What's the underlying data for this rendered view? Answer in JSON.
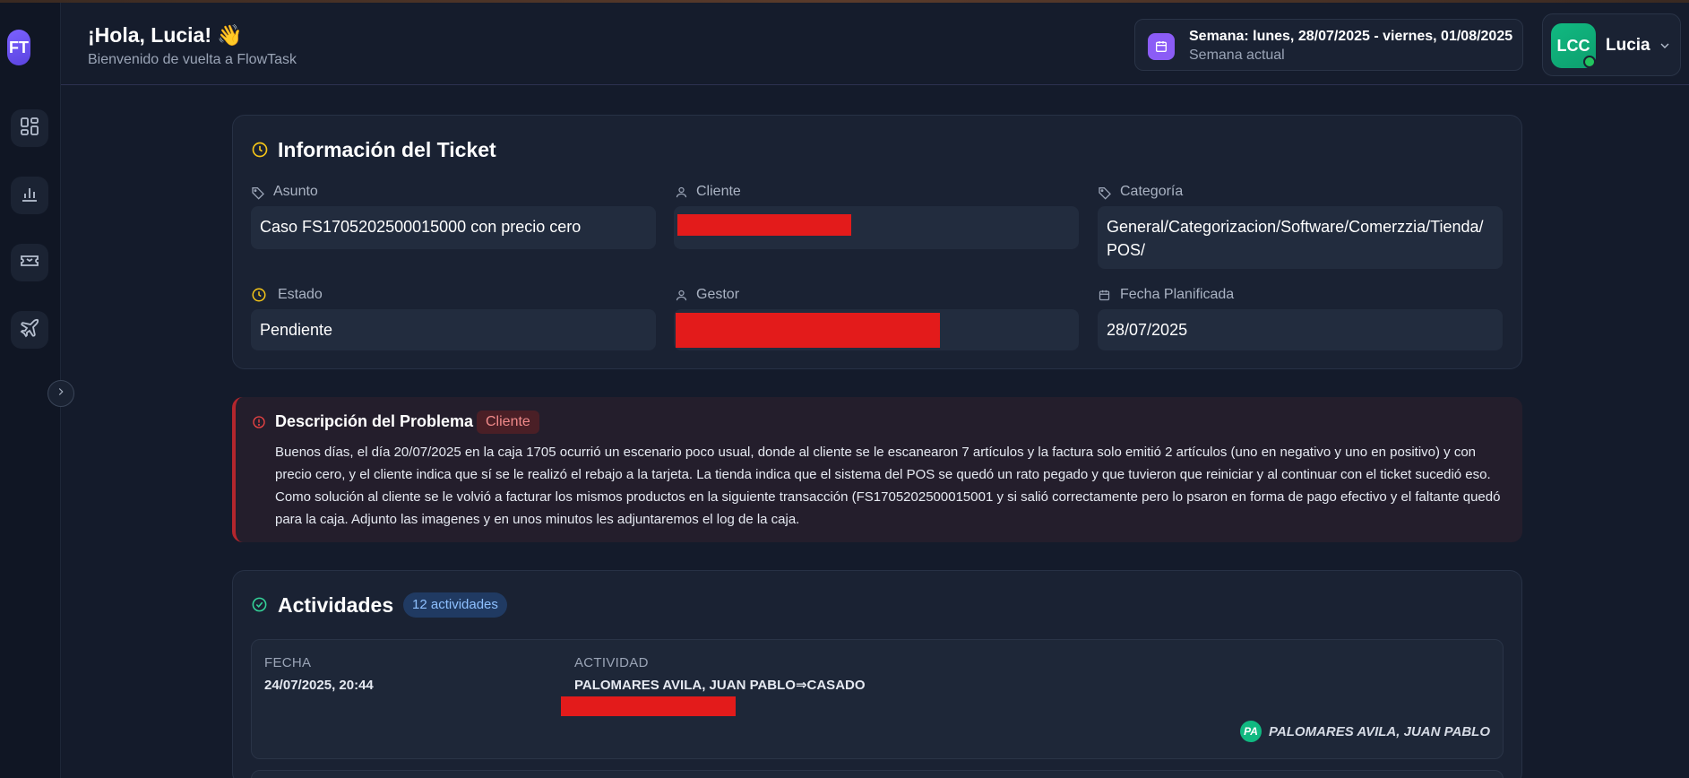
{
  "header": {
    "greeting": "¡Hola, Lucia! 👋",
    "subtitle": "Bienvenido de vuelta a FlowTask",
    "week_title": "Semana: lunes, 28/07/2025 - viernes, 01/08/2025",
    "week_sub": "Semana actual",
    "user_initials": "LCC",
    "user_name": "Lucia"
  },
  "sidebar": {
    "logo": "FT",
    "items": [
      {
        "name": "dashboard-icon"
      },
      {
        "name": "chart-icon"
      },
      {
        "name": "ticket-icon"
      },
      {
        "name": "plane-icon"
      }
    ]
  },
  "ticket_info": {
    "title": "Información del Ticket",
    "fields": {
      "asunto_label": "Asunto",
      "asunto_value": "Caso FS1705202500015000 con precio cero",
      "cliente_label": "Cliente",
      "categoria_label": "Categoría",
      "categoria_value": "General/Categorizacion/Software/Comerzzia/Tienda/POS/",
      "estado_label": "Estado",
      "estado_value": "Pendiente",
      "gestor_label": "Gestor",
      "fecha_label": "Fecha Planificada",
      "fecha_value": "28/07/2025"
    }
  },
  "problem": {
    "title": "Descripción del Problema",
    "badge": "Cliente",
    "text": "Buenos días, el día 20/07/2025 en la caja 1705 ocurrió un escenario poco usual, donde al cliente se le escanearon 7 artículos y la factura solo emitió 2 artículos (uno en negativo y uno en positivo) y con precio cero, y el cliente indica que sí se le realizó el rebajo a la tarjeta. La tienda indica que el sistema del POS se quedó un rato pegado y que tuvieron que reiniciar y al continuar con el ticket sucedió eso. Como solución al cliente se le volvió a facturar los mismos productos en la siguiente transacción (FS1705202500015001 y si salió correctamente pero lo psaron en forma de pago efectivo y el faltante quedó para la caja. Adjunto las imagenes y en unos minutos les adjuntaremos el log de la caja."
  },
  "activities": {
    "title": "Actividades",
    "count": "12 actividades",
    "col_fecha": "FECHA",
    "col_actividad": "ACTIVIDAD",
    "rows": [
      {
        "fecha": "24/07/2025, 20:44",
        "actividad": "PALOMARES AVILA, JUAN PABLO⇒CASADO",
        "user_initials": "PA",
        "user_name": "PALOMARES AVILA, JUAN PABLO"
      }
    ]
  },
  "colors": {
    "accent_purple": "#8b5cf6",
    "accent_green": "#10b981",
    "accent_yellow": "#f5c518",
    "danger_red": "#b3262d"
  }
}
